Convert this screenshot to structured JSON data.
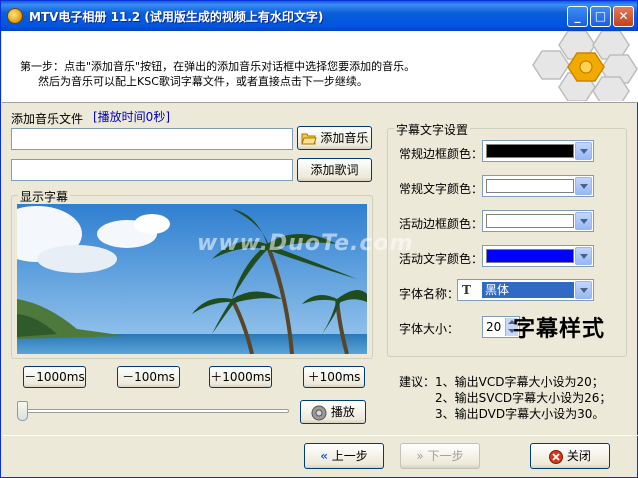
{
  "window": {
    "title": "MTV电子相册 11.2 (试用版生成的视频上有水印文字)"
  },
  "header": {
    "line1": "第一步：点击\"添加音乐\"按钮，在弹出的添加音乐对话框中选择您要添加的音乐。",
    "line2": "然后为音乐可以配上KSC歌词字幕文件，或者直接点击下一步继续。"
  },
  "music": {
    "label": "添加音乐文件",
    "duration": "[播放时间0秒]",
    "file_value": "",
    "lyrics_value": "",
    "add_music_label": "添加音乐",
    "add_lyrics_label": "添加歌词"
  },
  "preview": {
    "group_title": "显示字幕",
    "watermark": "www.DuoTe.com"
  },
  "seek": {
    "minus1000": "－1000ms",
    "minus100": "－100ms",
    "plus1000": "＋1000ms",
    "plus100": "＋100ms",
    "play_label": "播放",
    "position": 0
  },
  "subtitle": {
    "group_title": "字幕文字设置",
    "normal_border_label": "常规边框颜色：",
    "normal_text_label": "常规文字颜色：",
    "active_border_label": "活动边框颜色：",
    "active_text_label": "活动文字颜色：",
    "font_name_label": "字体名称：",
    "font_name_value": "黑体",
    "font_size_label": "字体大小：",
    "font_size_value": "20",
    "sample_text": "字幕样式",
    "colors": {
      "normal_border": "#000000",
      "normal_text": "#ffffff",
      "active_border": "#ffffff",
      "active_text": "#0000ff"
    }
  },
  "tips": {
    "prefix": "建议：",
    "items": [
      "1、输出VCD字幕大小设为20；",
      "2、输出SVCD字幕大小设为26；",
      "3、输出DVD字幕大小设为30。"
    ]
  },
  "nav": {
    "prev_label": "上一步",
    "next_label": "下一步",
    "close_label": "关闭"
  },
  "accent": "#0053e1"
}
